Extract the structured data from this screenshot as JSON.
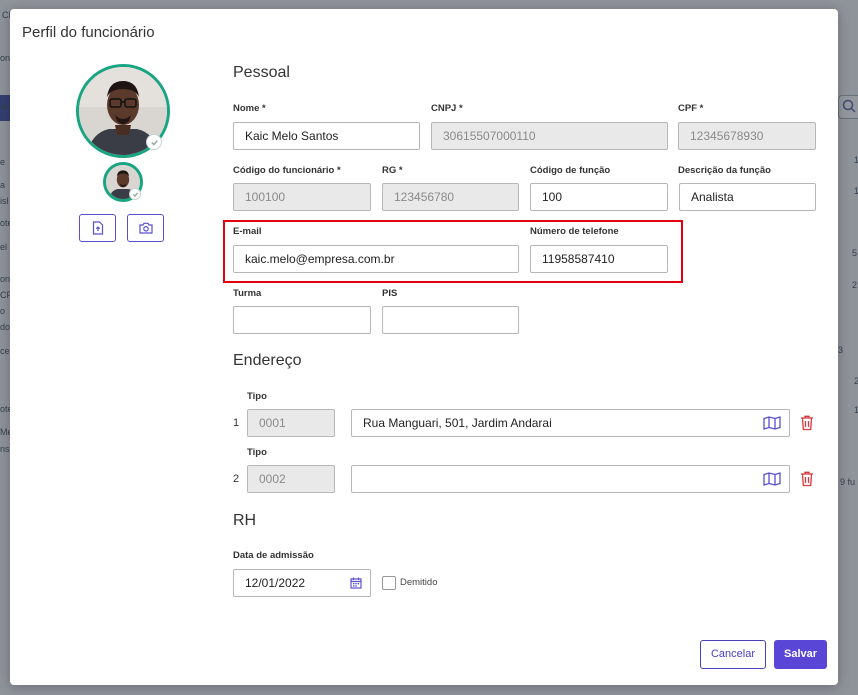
{
  "modal": {
    "title": "Perfil do funcionário"
  },
  "sections": {
    "pessoal": "Pessoal",
    "endereco": "Endereço",
    "rh": "RH"
  },
  "fields": {
    "nome": {
      "label": "Nome *",
      "value": "Kaic Melo Santos"
    },
    "cnpj": {
      "label": "CNPJ *",
      "value": "30615507000110"
    },
    "cpf": {
      "label": "CPF *",
      "value": "12345678930"
    },
    "codigo_funcionario": {
      "label": "Código do funcionário *",
      "value": "100100"
    },
    "rg": {
      "label": "RG *",
      "value": "123456780"
    },
    "codigo_funcao": {
      "label": "Código de função",
      "value": "100"
    },
    "descricao_funcao": {
      "label": "Descrição da função",
      "value": "Analista"
    },
    "email": {
      "label": "E-mail",
      "value": "kaic.melo@empresa.com.br"
    },
    "telefone": {
      "label": "Número de telefone",
      "value": "11958587410"
    },
    "turma": {
      "label": "Turma",
      "value": ""
    },
    "pis": {
      "label": "PIS",
      "value": ""
    }
  },
  "enderecos": [
    {
      "num": "1",
      "tipo_label": "Tipo",
      "tipo": "0001",
      "endereco": "Rua Manguari, 501, Jardim Andarai"
    },
    {
      "num": "2",
      "tipo_label": "Tipo",
      "tipo": "0002",
      "endereco": ""
    }
  ],
  "rh": {
    "admissao_label": "Data de admissão",
    "admissao_value": "12/01/2022",
    "demitido_label": "Demitido",
    "demitido_checked": false
  },
  "buttons": {
    "cancel": "Cancelar",
    "save": "Salvar"
  },
  "background": {
    "fragments": [
      "CL",
      "ona",
      "di",
      "e",
      "a",
      "isl",
      "ote",
      "el",
      "on",
      "CP",
      "o",
      "do",
      "ceu",
      "ote",
      "Me",
      "ns",
      "1",
      "1",
      "5",
      "2",
      "3",
      "2",
      "1",
      "9 fu"
    ]
  },
  "colors": {
    "accent": "#5a46d6",
    "avatar_ring": "#1aa582",
    "highlight": "#e3000f",
    "delete": "#d9363e"
  }
}
